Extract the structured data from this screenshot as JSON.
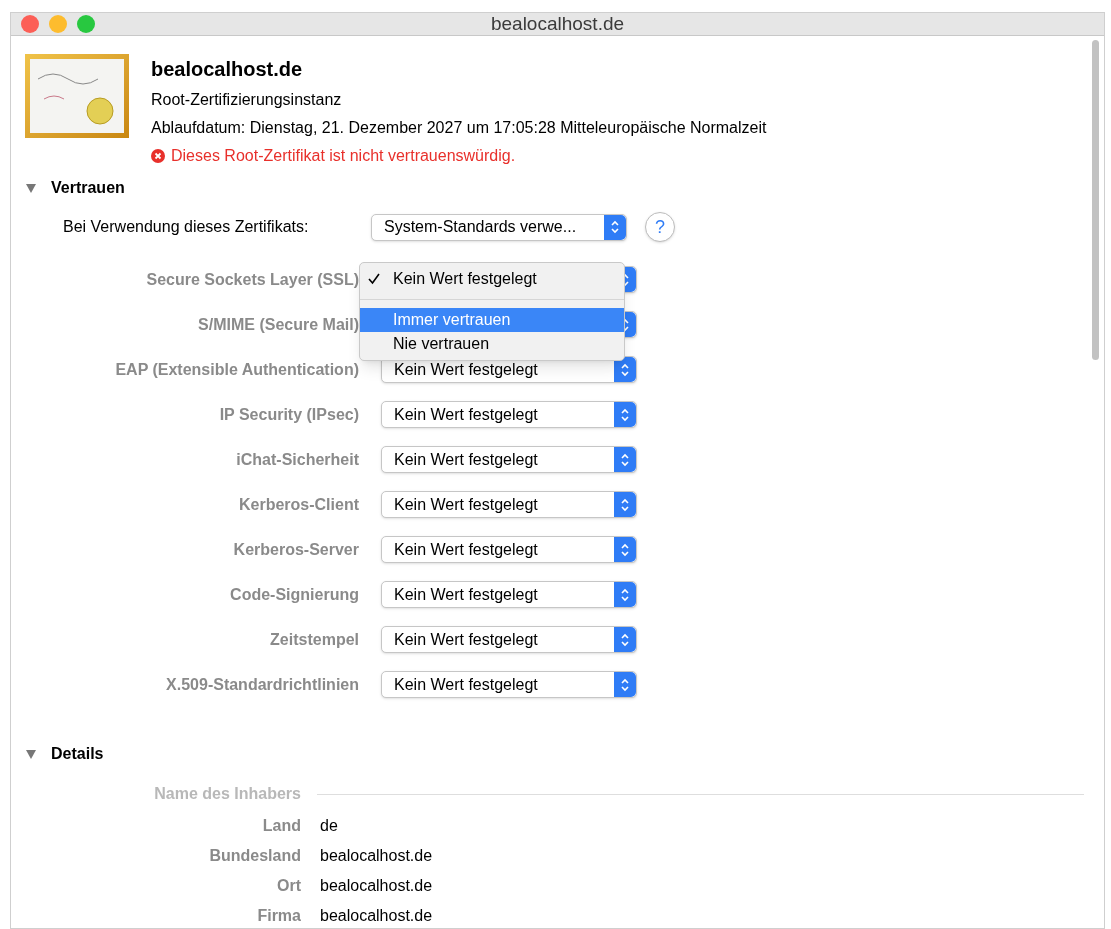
{
  "window": {
    "title": "bealocalhost.de"
  },
  "certificate": {
    "name": "bealocalhost.de",
    "type": "Root-Zertifizierungsinstanz",
    "expiry": "Ablaufdatum: Dienstag, 21. Dezember 2027 um 17:05:28 Mitteleuropäische Normalzeit",
    "warning": "Dieses Root-Zertifikat ist nicht vertrauenswürdig."
  },
  "trust": {
    "title": "Vertrauen",
    "expanded": true,
    "usage_label": "Bei Verwendung dieses Zertifikats:",
    "usage_value": "System-Standards verwe...",
    "help": "?",
    "rows": [
      {
        "label": "Secure Sockets Layer (SSL)"
      },
      {
        "label": "S/MIME (Secure Mail)"
      },
      {
        "label": "EAP (Extensible Authentication)",
        "value": "Kein Wert festgelegt"
      },
      {
        "label": "IP Security (IPsec)",
        "value": "Kein Wert festgelegt"
      },
      {
        "label": "iChat-Sicherheit",
        "value": "Kein Wert festgelegt"
      },
      {
        "label": "Kerberos-Client",
        "value": "Kein Wert festgelegt"
      },
      {
        "label": "Kerberos-Server",
        "value": "Kein Wert festgelegt"
      },
      {
        "label": "Code-Signierung",
        "value": "Kein Wert festgelegt"
      },
      {
        "label": "Zeitstempel",
        "value": "Kein Wert festgelegt"
      },
      {
        "label": "X.509-Standardrichtlinien",
        "value": "Kein Wert festgelegt"
      }
    ],
    "popup": [
      {
        "label": "Kein Wert festgelegt",
        "checked": true,
        "selected": false
      },
      {
        "label": "Immer vertrauen",
        "checked": false,
        "selected": true
      },
      {
        "label": "Nie vertrauen",
        "checked": false,
        "selected": false
      }
    ]
  },
  "details": {
    "title": "Details",
    "expanded": true,
    "section": "Name des Inhabers",
    "rows": [
      {
        "label": "Land",
        "value": "de"
      },
      {
        "label": "Bundesland",
        "value": "bealocalhost.de"
      },
      {
        "label": "Ort",
        "value": "bealocalhost.de"
      },
      {
        "label": "Firma",
        "value": "bealocalhost.de"
      }
    ]
  }
}
